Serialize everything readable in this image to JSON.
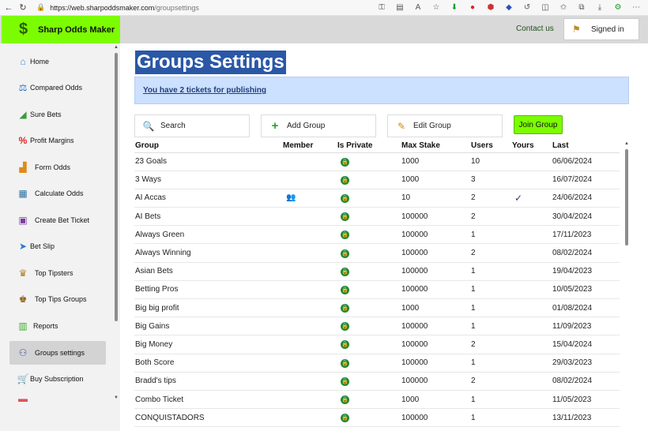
{
  "browser": {
    "url_host": "https://web.sharpoddsmaker.com",
    "url_path": "/groupsettings",
    "icons": [
      "key-icon",
      "reader-icon",
      "read-aloud-icon",
      "favorite-icon",
      "download-ext-icon",
      "ext-red-icon",
      "ext-ublock-icon",
      "ext-blue-icon",
      "refresh-ext-icon",
      "split-icon",
      "favorites-icon",
      "collections-icon",
      "downloads-icon",
      "extensions-icon",
      "menu-icon"
    ]
  },
  "header": {
    "brand_name": "Sharp Odds Maker",
    "contact_label": "Contact us",
    "signed_in_label": "Signed in"
  },
  "sidebar": {
    "items": [
      {
        "label": "Home",
        "icon": "home-icon"
      },
      {
        "label": "Compared Odds",
        "icon": "scales-icon"
      },
      {
        "label": "Sure Bets",
        "icon": "chart-icon"
      },
      {
        "label": "Profit Margins",
        "icon": "percent-icon"
      },
      {
        "label": "Form Odds",
        "icon": "bar-chart-icon"
      },
      {
        "label": "Calculate Odds",
        "icon": "calculator-icon"
      },
      {
        "label": "Create Bet Ticket",
        "icon": "ticket-icon"
      },
      {
        "label": "Bet Slip",
        "icon": "paper-plane-icon"
      },
      {
        "label": "Top Tipsters",
        "icon": "tipster-icon"
      },
      {
        "label": "Top Tips Groups",
        "icon": "crown-icon"
      },
      {
        "label": "Reports",
        "icon": "reports-icon"
      },
      {
        "label": "Groups settings",
        "icon": "groups-icon",
        "active": true
      },
      {
        "label": "Buy Subscription",
        "icon": "cart-icon"
      }
    ]
  },
  "main": {
    "title": "Groups Settings",
    "notice": "You have 2 tickets for publishing",
    "toolbar": {
      "search_label": "Search",
      "add_label": "Add Group",
      "edit_label": "Edit Group",
      "join_label": "Join Group"
    },
    "table": {
      "headers": [
        "Group",
        "Member",
        "Is Private",
        "Max Stake",
        "Users",
        "Yours",
        "Last"
      ],
      "rows": [
        {
          "group": "23 Goals",
          "member": false,
          "private": true,
          "max_stake": "1000",
          "users": "10",
          "yours": false,
          "last": "06/06/2024"
        },
        {
          "group": "3 Ways",
          "member": false,
          "private": true,
          "max_stake": "1000",
          "users": "3",
          "yours": false,
          "last": "16/07/2024"
        },
        {
          "group": "AI Accas",
          "member": true,
          "private": true,
          "max_stake": "10",
          "users": "2",
          "yours": true,
          "last": "24/06/2024"
        },
        {
          "group": "AI Bets",
          "member": false,
          "private": true,
          "max_stake": "100000",
          "users": "2",
          "yours": false,
          "last": "30/04/2024"
        },
        {
          "group": "Always Green",
          "member": false,
          "private": true,
          "max_stake": "100000",
          "users": "1",
          "yours": false,
          "last": "17/11/2023"
        },
        {
          "group": "Always Winning",
          "member": false,
          "private": true,
          "max_stake": "100000",
          "users": "2",
          "yours": false,
          "last": "08/02/2024"
        },
        {
          "group": "Asian Bets",
          "member": false,
          "private": true,
          "max_stake": "100000",
          "users": "1",
          "yours": false,
          "last": "19/04/2023"
        },
        {
          "group": "Betting Pros",
          "member": false,
          "private": true,
          "max_stake": "100000",
          "users": "1",
          "yours": false,
          "last": "10/05/2023"
        },
        {
          "group": "Big big profit",
          "member": false,
          "private": true,
          "max_stake": "1000",
          "users": "1",
          "yours": false,
          "last": "01/08/2024"
        },
        {
          "group": "Big Gains",
          "member": false,
          "private": true,
          "max_stake": "100000",
          "users": "1",
          "yours": false,
          "last": "11/09/2023"
        },
        {
          "group": "Big Money",
          "member": false,
          "private": true,
          "max_stake": "100000",
          "users": "2",
          "yours": false,
          "last": "15/04/2024"
        },
        {
          "group": "Both Score",
          "member": false,
          "private": true,
          "max_stake": "100000",
          "users": "1",
          "yours": false,
          "last": "29/03/2023"
        },
        {
          "group": "Bradd's tips",
          "member": false,
          "private": true,
          "max_stake": "100000",
          "users": "2",
          "yours": false,
          "last": "08/02/2024"
        },
        {
          "group": "Combo Ticket",
          "member": false,
          "private": true,
          "max_stake": "1000",
          "users": "1",
          "yours": false,
          "last": "11/05/2023"
        },
        {
          "group": "CONQUISTADORS",
          "member": false,
          "private": true,
          "max_stake": "100000",
          "users": "1",
          "yours": false,
          "last": "13/11/2023"
        }
      ]
    }
  }
}
